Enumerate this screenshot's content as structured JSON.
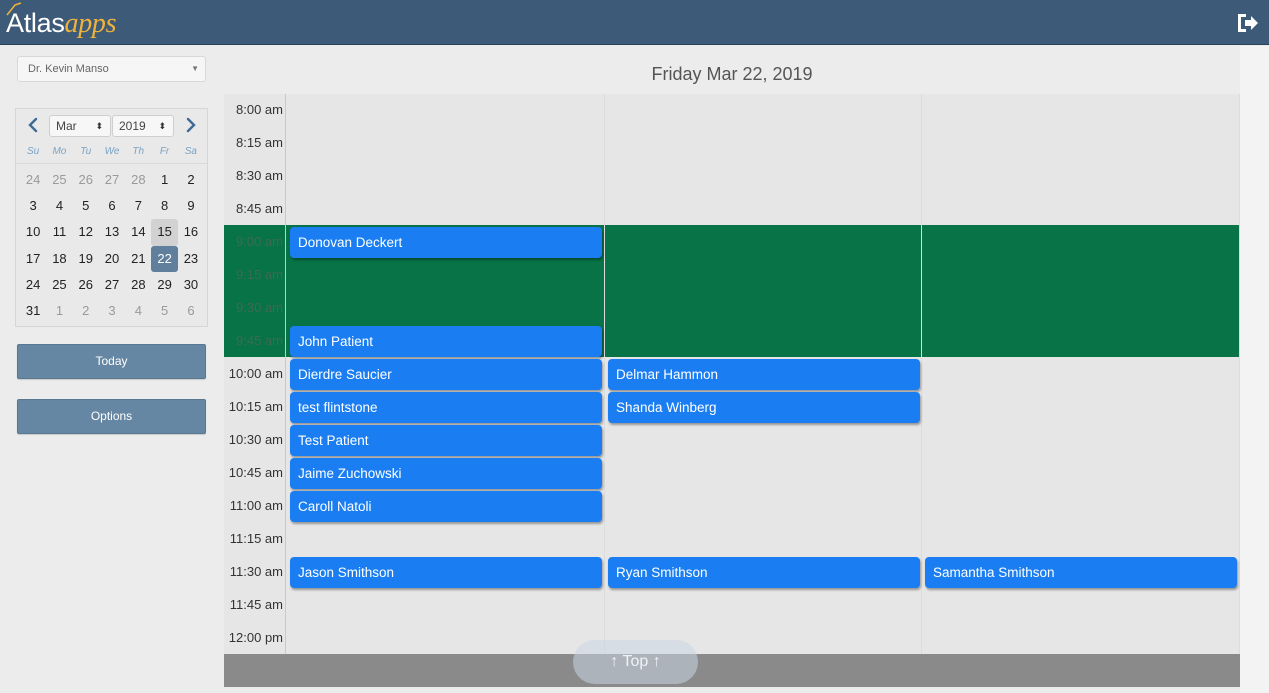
{
  "header": {
    "logo_main": "Atlas",
    "logo_accent": "apps",
    "signout_icon": "sign-out-icon"
  },
  "sidebar": {
    "provider": "Dr. Kevin Manso",
    "calendar": {
      "month": "Mar",
      "year": "2019",
      "weekdays": [
        "Su",
        "Mo",
        "Tu",
        "We",
        "Th",
        "Fr",
        "Sa"
      ],
      "weeks": [
        [
          "24",
          "25",
          "26",
          "27",
          "28",
          "1",
          "2"
        ],
        [
          "3",
          "4",
          "5",
          "6",
          "7",
          "8",
          "9"
        ],
        [
          "10",
          "11",
          "12",
          "13",
          "14",
          "15",
          "16"
        ],
        [
          "17",
          "18",
          "19",
          "20",
          "21",
          "22",
          "23"
        ],
        [
          "24",
          "25",
          "26",
          "27",
          "28",
          "29",
          "30"
        ],
        [
          "31",
          "1",
          "2",
          "3",
          "4",
          "5",
          "6"
        ]
      ],
      "selected_day": "22",
      "hover_day": "15"
    },
    "today_label": "Today",
    "options_label": "Options"
  },
  "main": {
    "title": "Friday Mar 22, 2019",
    "times": [
      "8:00 am",
      "8:15 am",
      "8:30 am",
      "8:45 am",
      "9:00 am",
      "9:15 am",
      "9:30 am",
      "9:45 am",
      "10:00 am",
      "10:15 am",
      "10:30 am",
      "10:45 am",
      "11:00 am",
      "11:15 am",
      "11:30 am",
      "11:45 am",
      "12:00 pm"
    ],
    "appointments": [
      {
        "name": "Donovan Deckert",
        "time": "9:00 am",
        "column": 1
      },
      {
        "name": "John Patient",
        "time": "9:45 am",
        "column": 1
      },
      {
        "name": "Dierdre Saucier",
        "time": "10:00 am",
        "column": 1
      },
      {
        "name": "Delmar Hammon",
        "time": "10:00 am",
        "column": 2
      },
      {
        "name": "test flintstone",
        "time": "10:15 am",
        "column": 1
      },
      {
        "name": "Shanda Winberg",
        "time": "10:15 am",
        "column": 2
      },
      {
        "name": "Test Patient",
        "time": "10:30 am",
        "column": 1
      },
      {
        "name": "Jaime Zuchowski",
        "time": "10:45 am",
        "column": 1
      },
      {
        "name": "Caroll Natoli",
        "time": "11:00 am",
        "column": 1
      },
      {
        "name": "Jason Smithson",
        "time": "11:30 am",
        "column": 1
      },
      {
        "name": "Ryan Smithson",
        "time": "11:30 am",
        "column": 2
      },
      {
        "name": "Samantha Smithson",
        "time": "11:30 am",
        "column": 3
      }
    ],
    "top_label": "↑ Top ↑",
    "colors": {
      "appointment": "#1a7ef2",
      "blocked": "#077346",
      "header": "#3d5a78"
    }
  }
}
